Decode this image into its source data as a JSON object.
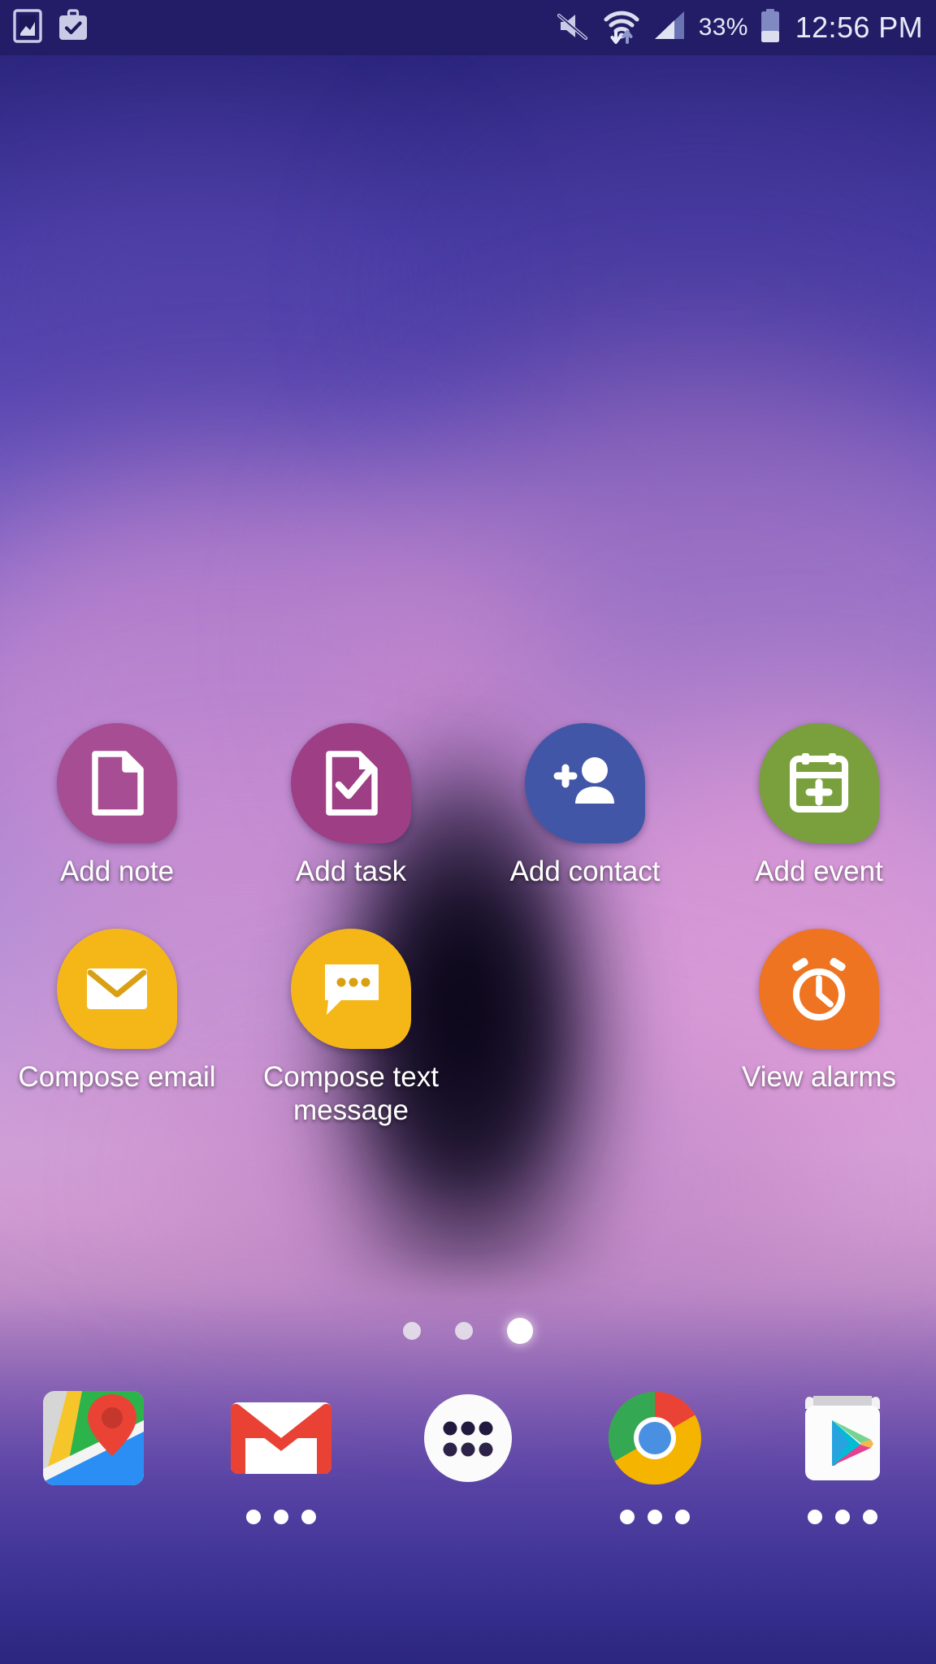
{
  "status_bar": {
    "left_icons": [
      {
        "name": "screenshot-icon",
        "label": "Screenshot"
      },
      {
        "name": "work-profile-icon",
        "label": "Work profile"
      }
    ],
    "right_icons": [
      {
        "name": "volume-mute-icon",
        "label": "Ringer silent"
      },
      {
        "name": "wifi-data-transfer-icon",
        "label": "Wi-Fi"
      },
      {
        "name": "cellular-signal-icon",
        "label": "Signal",
        "bars_filled": 2,
        "bars_total": 4
      }
    ],
    "battery_percent": "33%",
    "battery_level": 33,
    "clock": "12:56 PM"
  },
  "shortcuts": {
    "row1": [
      {
        "label": "Add note",
        "icon": "document-icon",
        "color": "#a74d93"
      },
      {
        "label": "Add task",
        "icon": "document-check-icon",
        "color": "#9e3f86"
      },
      {
        "label": "Add contact",
        "icon": "person-add-icon",
        "color": "#4256a8"
      },
      {
        "label": "Add event",
        "icon": "calendar-add-icon",
        "color": "#7aa03e"
      }
    ],
    "row2": [
      {
        "label": "Compose email",
        "icon": "envelope-icon",
        "color": "#f5b718"
      },
      {
        "label": "Compose text message",
        "icon": "speech-bubble-icon",
        "color": "#f5b718"
      },
      {
        "label": "",
        "icon": "",
        "color": ""
      },
      {
        "label": "View alarms",
        "icon": "alarm-clock-icon",
        "color": "#ef7421"
      }
    ]
  },
  "page_indicator": {
    "total_pages": 3,
    "active_page": 3
  },
  "dock": [
    {
      "label": "Maps",
      "icon": "google-maps-icon",
      "has_folder_dots": false
    },
    {
      "label": "Gmail",
      "icon": "gmail-icon",
      "has_folder_dots": true
    },
    {
      "label": "Apps",
      "icon": "app-drawer-icon",
      "has_folder_dots": false
    },
    {
      "label": "Chrome",
      "icon": "chrome-icon",
      "has_folder_dots": true
    },
    {
      "label": "Play Store",
      "icon": "play-store-icon",
      "has_folder_dots": true
    }
  ],
  "colors": {
    "status_bar_bg": "#221d66",
    "status_text": "#e9eaf8",
    "label_text": "#ffffff"
  }
}
